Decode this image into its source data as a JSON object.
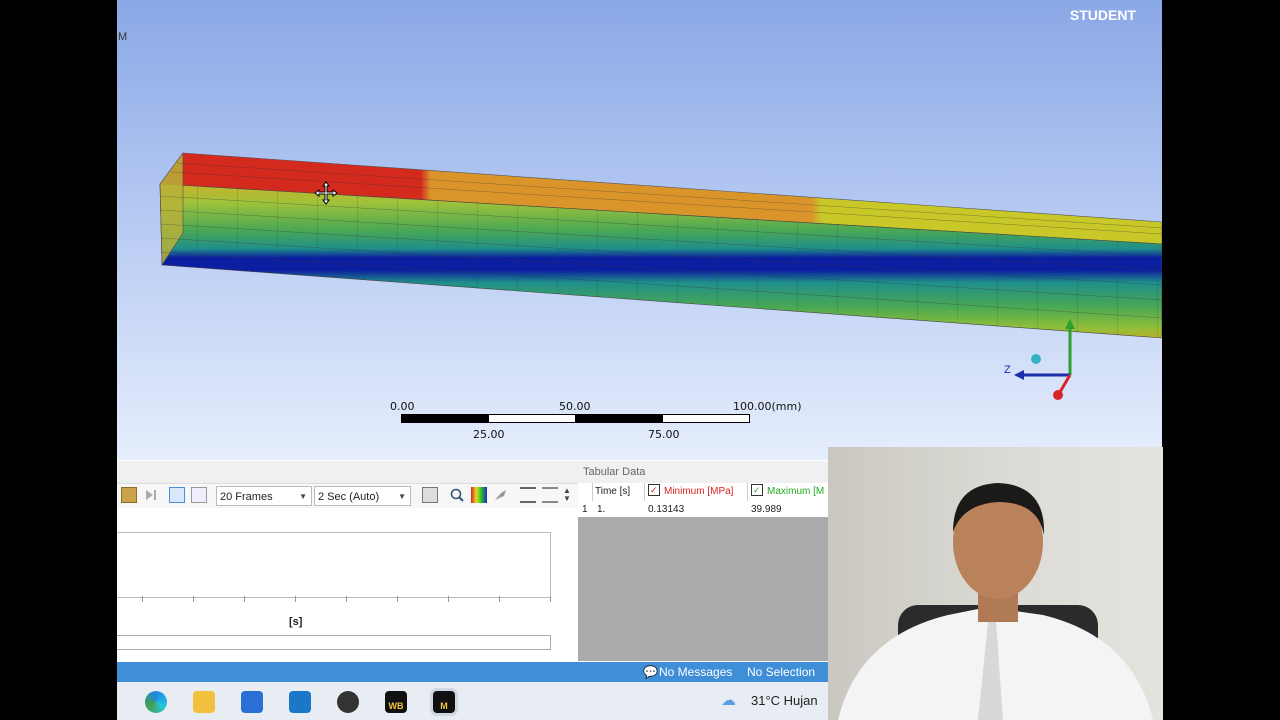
{
  "viewport": {
    "watermark": "STUDENT",
    "corner_letter": "M",
    "scale_bar": {
      "top_labels": [
        "0.00",
        "50.00",
        "100.00(mm)"
      ],
      "bottom_labels": [
        "25.00",
        "75.00"
      ]
    },
    "axis_label": "Z"
  },
  "animation_toolbar": {
    "frames_select": "20 Frames",
    "duration_select": "2 Sec (Auto)",
    "x_axis_unit": "[s]"
  },
  "tabular": {
    "title": "Tabular Data",
    "columns": [
      "Time [s]",
      "Minimum [MPa]",
      "Maximum [M"
    ],
    "rows": [
      {
        "index": "1",
        "time": "1.",
        "min": "0.13143",
        "max": "39.989"
      }
    ]
  },
  "status_bar": {
    "messages": "No Messages",
    "selection": "No Selection"
  },
  "taskbar": {
    "weather": "31°C  Hujan",
    "wb_label": "WB",
    "m_label": "M"
  },
  "colors": {
    "status_blue": "#3f8ed8",
    "stress_red": "#d42a1e",
    "stress_orange": "#d9952a",
    "stress_yellow": "#c8c829",
    "stress_green": "#56b04a",
    "stress_blue": "#0c1fa0"
  }
}
